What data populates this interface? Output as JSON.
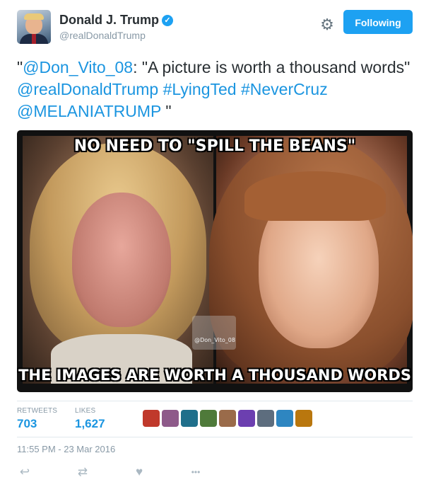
{
  "user": {
    "name": "Donald J. Trump",
    "handle": "@realDonaldTrump",
    "verified_icon": "✓"
  },
  "follow_button": {
    "label": "Following",
    "color": "#1da1f2"
  },
  "settings_icon": "gear-icon",
  "tweet": {
    "parts": [
      {
        "text": "\"",
        "link": false
      },
      {
        "text": "@Don_Vito_08",
        "link": true
      },
      {
        "text": ": \"A picture is worth a thousand words\" ",
        "link": false
      },
      {
        "text": "@realDonaldTrump",
        "link": true
      },
      {
        "text": " ",
        "link": false
      },
      {
        "text": "#LyingTed",
        "link": true
      },
      {
        "text": " ",
        "link": false
      },
      {
        "text": "#NeverCruz",
        "link": true
      },
      {
        "text": " ",
        "link": false
      },
      {
        "text": "@MELANIATRUMP",
        "link": true
      },
      {
        "text": " \"",
        "link": false
      }
    ]
  },
  "media": {
    "caption_top": "NO NEED TO \"SPILL THE BEANS\"",
    "caption_bottom": "THE IMAGES ARE WORTH A THOUSAND WORDS",
    "watermark": "@Don_Vito_08"
  },
  "stats": {
    "retweets_label": "RETWEETS",
    "retweets_value": "703",
    "likes_label": "LIKES",
    "likes_value": "1,627",
    "liker_colors": [
      "#c0392b",
      "#8e5a8a",
      "#1f6f8b",
      "#4f7a3a",
      "#9a6b4a",
      "#6c3fb0",
      "#5d6d7e",
      "#2e86c1",
      "#b9770e"
    ]
  },
  "timestamp": "11:55 PM - 23 Mar 2016",
  "actions": {
    "reply_icon": "↩",
    "retweet_icon": "⇄",
    "like_icon": "♥",
    "more_icon": "•••"
  },
  "colors": {
    "link": "#1b95e0",
    "muted": "#8899a6",
    "text": "#292f33"
  }
}
